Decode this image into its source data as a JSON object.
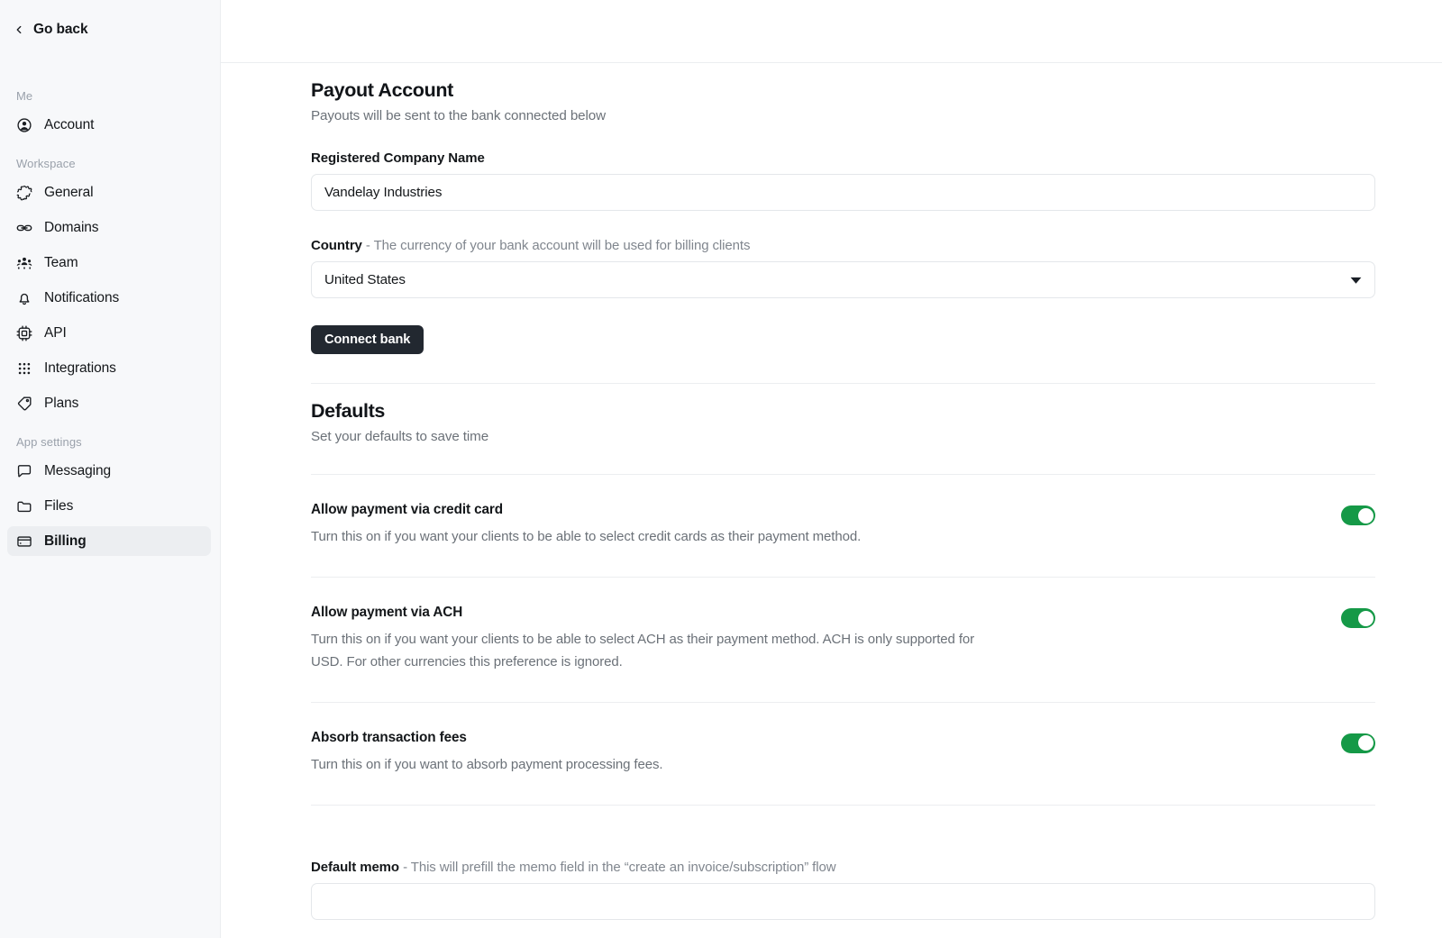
{
  "sidebar": {
    "back": {
      "label": "Go back",
      "icon": "chevron-left-icon"
    },
    "sections": [
      {
        "label": "Me",
        "items": [
          {
            "label": "Account",
            "icon": "user-circle-icon",
            "active": false
          }
        ]
      },
      {
        "label": "Workspace",
        "items": [
          {
            "label": "General",
            "icon": "puzzle-piece-icon",
            "active": false
          },
          {
            "label": "Domains",
            "icon": "link-icon",
            "active": false
          },
          {
            "label": "Team",
            "icon": "people-icon",
            "active": false
          },
          {
            "label": "Notifications",
            "icon": "bell-icon",
            "active": false
          },
          {
            "label": "API",
            "icon": "chip-icon",
            "active": false
          },
          {
            "label": "Integrations",
            "icon": "grid-dots-icon",
            "active": false
          },
          {
            "label": "Plans",
            "icon": "tag-icon",
            "active": false
          }
        ]
      },
      {
        "label": "App settings",
        "items": [
          {
            "label": "Messaging",
            "icon": "chat-bubble-icon",
            "active": false
          },
          {
            "label": "Files",
            "icon": "folder-icon",
            "active": false
          },
          {
            "label": "Billing",
            "icon": "credit-card-icon",
            "active": true
          }
        ]
      }
    ]
  },
  "payout": {
    "title": "Payout Account",
    "subtitle": "Payouts will be sent to the bank connected below",
    "company_label": "Registered Company Name",
    "company_value": "Vandelay Industries",
    "company_placeholder": "",
    "country_label": "Country",
    "country_hint": "- The currency of your bank account will be used for billing clients",
    "country_value": "United States",
    "country_caret_icon": "chevron-down-icon",
    "connect_bank_label": "Connect bank"
  },
  "defaults": {
    "title": "Defaults",
    "subtitle": "Set your defaults to save time",
    "toggles": [
      {
        "title": "Allow payment via credit card",
        "desc": "Turn this on if you want your clients to be able to select credit cards as their payment method.",
        "on": true
      },
      {
        "title": "Allow payment via ACH",
        "desc": "Turn this on if you want your clients to be able to select ACH as their payment method. ACH is only supported for USD. For other currencies this preference is ignored.",
        "on": true
      },
      {
        "title": "Absorb transaction fees",
        "desc": "Turn this on if you want to absorb payment processing fees.",
        "on": true
      }
    ],
    "memo_label": "Default memo",
    "memo_hint": "- This will prefill the memo field in the “create an invoice/subscription” flow",
    "memo_value": "",
    "memo_placeholder": ""
  },
  "colors": {
    "toggle_on": "#159947",
    "button_dark": "#222830",
    "sidebar_bg": "#f7f8fa",
    "active_item_bg": "#eceef1"
  }
}
